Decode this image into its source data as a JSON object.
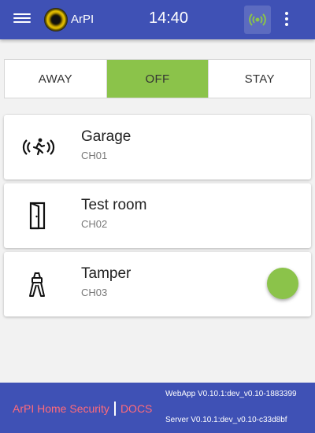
{
  "appbar": {
    "brand": "ArPI",
    "time": "14:40",
    "menu_icon": "menu-icon",
    "signal_icon": "broadcast-icon",
    "more_icon": "more-vert-icon"
  },
  "modes": {
    "items": [
      {
        "label": "AWAY",
        "active": false
      },
      {
        "label": "OFF",
        "active": true
      },
      {
        "label": "STAY",
        "active": false
      }
    ],
    "active_color": "#8bc34a"
  },
  "sensors": [
    {
      "name": "Garage",
      "channel": "CH01",
      "icon": "motion-sensor-icon",
      "alert": false
    },
    {
      "name": "Test room",
      "channel": "CH02",
      "icon": "door-icon",
      "alert": false
    },
    {
      "name": "Tamper",
      "channel": "CH03",
      "icon": "tamper-icon",
      "alert": true
    }
  ],
  "footer": {
    "home_link": "ArPI Home Security",
    "docs_link": "DOCS",
    "webapp_version": "WebApp V0.10.1:dev_v0.10-1883399",
    "server_version": "Server V0.10.1:dev_v0.10-c33d8bf"
  },
  "colors": {
    "primary": "#3f51b5",
    "accent_green": "#8bc34a",
    "link_red": "#ff6b7a"
  }
}
